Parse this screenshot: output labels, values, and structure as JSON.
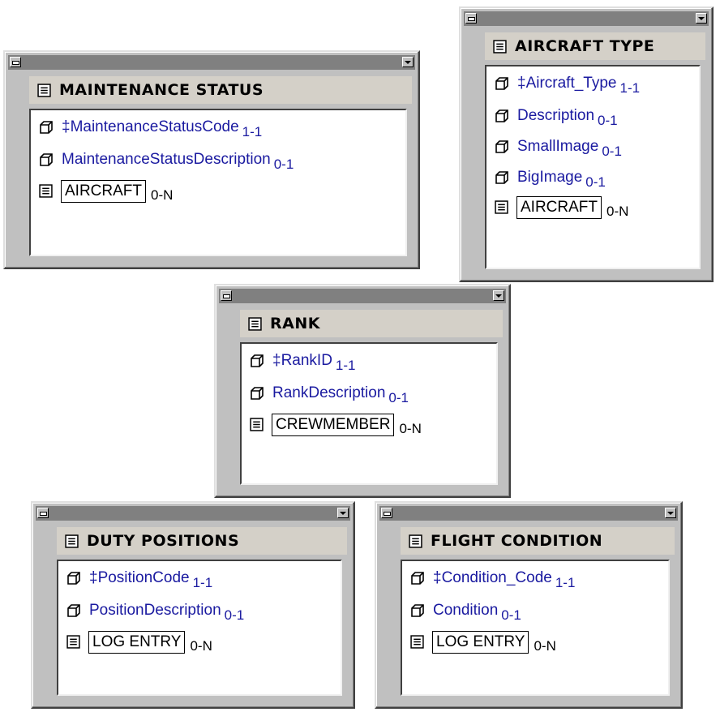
{
  "entities": {
    "maintenance_status": {
      "title": "MAINTENANCE STATUS",
      "attributes": [
        {
          "name": "‡MaintenanceStatusCode",
          "cardinality": "1-1"
        },
        {
          "name": "MaintenanceStatusDescription",
          "cardinality": "0-1"
        }
      ],
      "relation": {
        "entity": "AIRCRAFT",
        "cardinality": "0-N"
      }
    },
    "aircraft_type": {
      "title": "AIRCRAFT TYPE",
      "attributes": [
        {
          "name": "‡Aircraft_Type",
          "cardinality": "1-1"
        },
        {
          "name": "Description",
          "cardinality": "0-1"
        },
        {
          "name": "SmallImage",
          "cardinality": "0-1"
        },
        {
          "name": "BigImage",
          "cardinality": "0-1"
        }
      ],
      "relation": {
        "entity": "AIRCRAFT",
        "cardinality": "0-N"
      }
    },
    "rank": {
      "title": "RANK",
      "attributes": [
        {
          "name": "‡RankID",
          "cardinality": "1-1"
        },
        {
          "name": "RankDescription",
          "cardinality": "0-1"
        }
      ],
      "relation": {
        "entity": "CREWMEMBER",
        "cardinality": "0-N"
      }
    },
    "duty_positions": {
      "title": "DUTY POSITIONS",
      "attributes": [
        {
          "name": "‡PositionCode",
          "cardinality": "1-1"
        },
        {
          "name": "PositionDescription",
          "cardinality": "0-1"
        }
      ],
      "relation": {
        "entity": "LOG ENTRY",
        "cardinality": "0-N"
      }
    },
    "flight_condition": {
      "title": "FLIGHT CONDITION",
      "attributes": [
        {
          "name": "‡Condition_Code",
          "cardinality": "1-1"
        },
        {
          "name": "Condition",
          "cardinality": "0-1"
        }
      ],
      "relation": {
        "entity": "LOG ENTRY",
        "cardinality": "0-N"
      }
    }
  },
  "icons": {
    "attribute": "attribute-icon",
    "entity": "entity-icon",
    "system_menu": "system-menu-icon",
    "dropdown": "dropdown-arrow-icon"
  },
  "colors": {
    "attribute_text": "#1a1aa0",
    "window_face": "#c0c0c0",
    "titlebar": "#808080"
  }
}
